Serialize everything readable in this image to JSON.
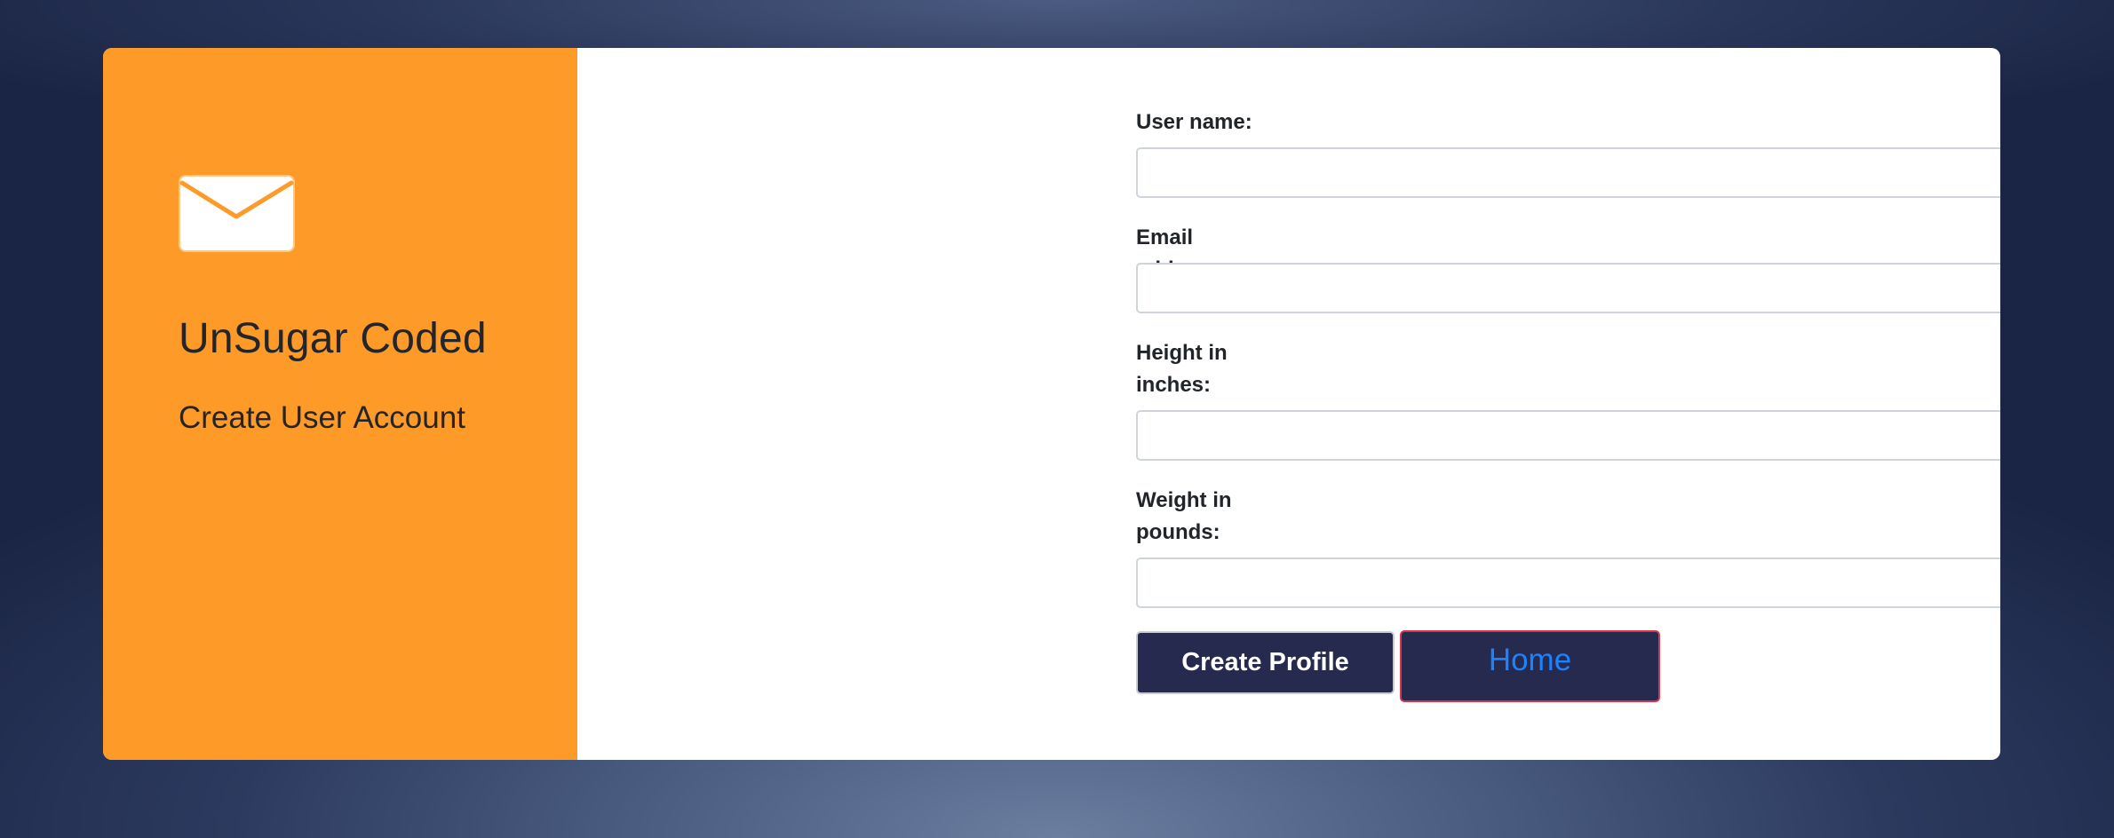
{
  "brand": {
    "title": "UnSugar Coded",
    "subtitle": "Create User Account",
    "icon": "envelope-icon"
  },
  "form": {
    "fields": [
      {
        "label": "User name:",
        "value": "",
        "placeholder": ""
      },
      {
        "label": "Email address:",
        "value": "",
        "placeholder": ""
      },
      {
        "label": "Height in inches:",
        "value": "",
        "placeholder": ""
      },
      {
        "label": "Weight in pounds:",
        "value": "",
        "placeholder": ""
      }
    ],
    "submit_label": "Create Profile",
    "home_label": "Home"
  },
  "colors": {
    "left_panel": "#fd9a28",
    "button_bg": "#262a4f",
    "home_text": "#1d82ff",
    "home_border": "#dc3545"
  }
}
